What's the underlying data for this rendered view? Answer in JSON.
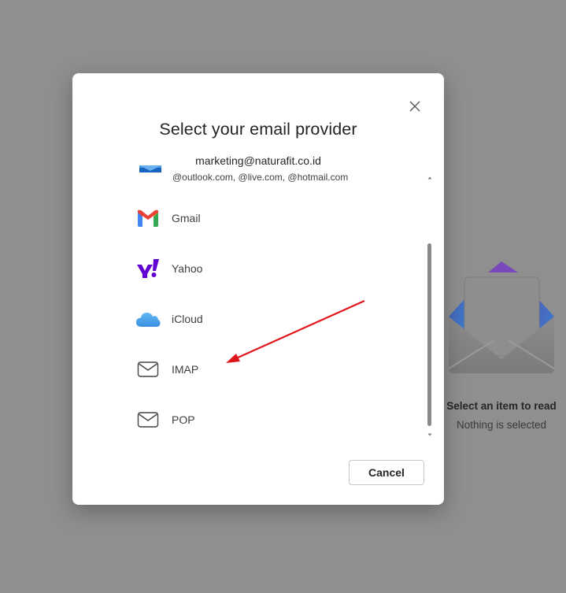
{
  "background": {
    "empty_state": {
      "title": "Select an item to read",
      "subtitle": "Nothing is selected"
    }
  },
  "dialog": {
    "title": "Select your email provider",
    "outlook": {
      "email": "marketing@naturafit.co.id",
      "domains": "@outlook.com, @live.com, @hotmail.com",
      "icon": "outlook-icon"
    },
    "providers": [
      {
        "label": "Gmail",
        "icon": "gmail-icon"
      },
      {
        "label": "Yahoo",
        "icon": "yahoo-icon"
      },
      {
        "label": "iCloud",
        "icon": "icloud-icon"
      },
      {
        "label": "IMAP",
        "icon": "mail-envelope-icon"
      },
      {
        "label": "POP",
        "icon": "mail-envelope-icon"
      }
    ],
    "cancel_label": "Cancel"
  },
  "colors": {
    "overlay": "#8f8f8f",
    "dialog_bg": "#ffffff",
    "annotation_arrow": "#e0141b",
    "yahoo_purple": "#6001d2",
    "outlook_blue": "#0f6cbd"
  }
}
